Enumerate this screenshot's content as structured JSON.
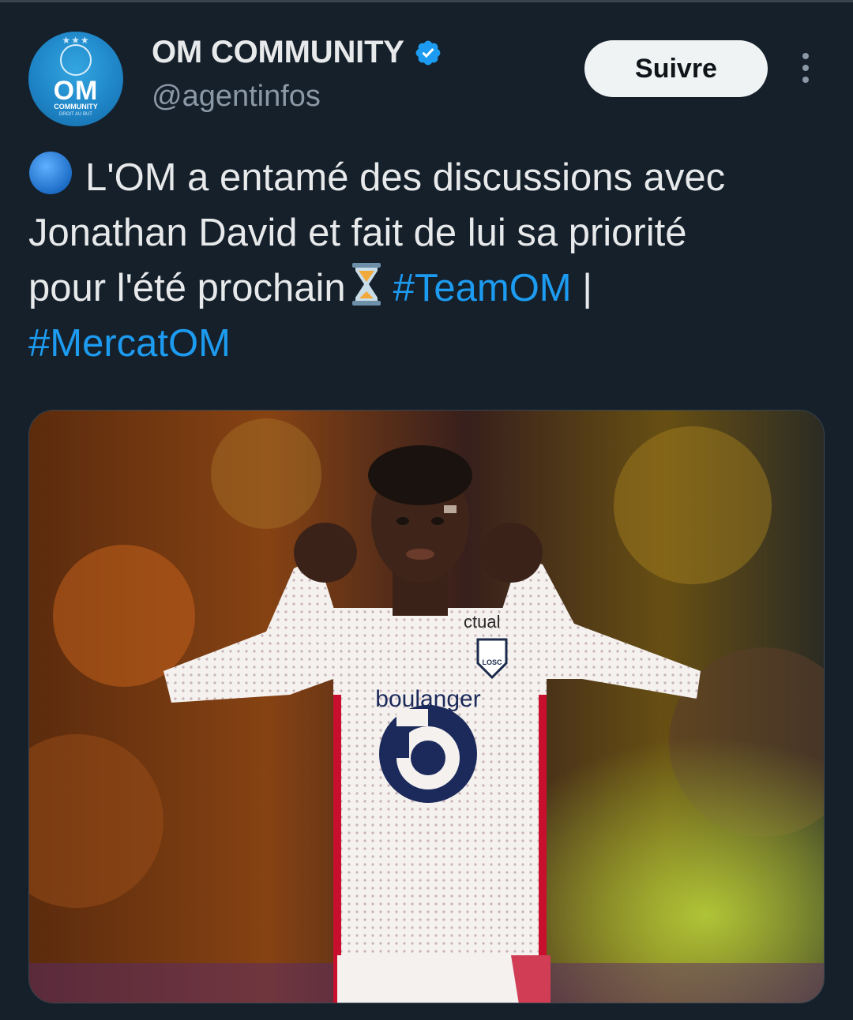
{
  "account": {
    "display_name": "OM COMMUNITY",
    "handle": "@agentinfos",
    "verified": true,
    "avatar_text": "OM",
    "avatar_subtext": "COMMUNITY",
    "avatar_tagline": "DROIT AU BUT"
  },
  "actions": {
    "follow_label": "Suivre",
    "more_icon": "more-vertical-icon"
  },
  "tweet": {
    "emoji_start": "blue-circle",
    "line1": "L'OM a entamé des discussions avec",
    "line2": "Jonathan David et fait de lui sa priorité",
    "line3_text": "pour l'été prochain",
    "emoji_mid": "hourglass",
    "hashtag1": "#TeamOM",
    "separator": "|",
    "hashtag2": "#MercatOM"
  },
  "media": {
    "jersey_sponsor": "boulanger",
    "jersey_partner_text": "ctual",
    "club_badge_text": "LOSC"
  },
  "colors": {
    "background": "#15202b",
    "text": "#e7e9ea",
    "secondary_text": "#8b98a5",
    "link": "#1d9bf0",
    "verified": "#1d9bf0",
    "follow_bg": "#eff3f4"
  }
}
